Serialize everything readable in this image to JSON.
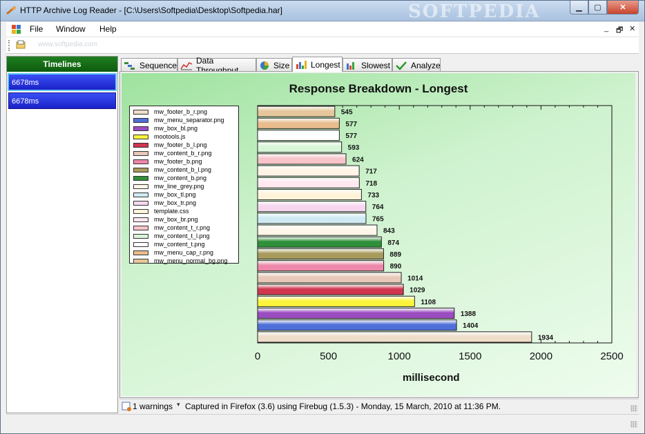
{
  "window": {
    "title": "HTTP Archive Log Reader - [C:\\Users\\Softpedia\\Desktop\\Softpedia.har]",
    "watermark": "SOFTPEDIA",
    "min_glyph": "▁",
    "max_glyph": "▢",
    "close_glyph": "✕"
  },
  "menu": {
    "file": "File",
    "window": "Window",
    "help": "Help",
    "mdi_min": "_",
    "mdi_restore": "🗗",
    "mdi_close": "✕"
  },
  "toolbar": {
    "watermark": "www.softpedia.com"
  },
  "sidebar": {
    "title": "Timelines",
    "items": [
      {
        "label": "6678ms"
      },
      {
        "label": "6678ms"
      }
    ]
  },
  "tabs": [
    {
      "label": "Sequence",
      "icon": "sequence-icon"
    },
    {
      "label": "Data Throughput",
      "icon": "throughput-icon"
    },
    {
      "label": "Size",
      "icon": "pie-chart-icon"
    },
    {
      "label": "Longest",
      "icon": "bar-chart-icon"
    },
    {
      "label": "Slowest",
      "icon": "bar-chart-icon"
    },
    {
      "label": "Analyze",
      "icon": "checkmark-icon"
    }
  ],
  "active_tab": "Longest",
  "chart_data": {
    "type": "bar",
    "orientation": "horizontal",
    "title": "Response Breakdown - Longest",
    "xlabel": "millisecond",
    "xlim": [
      0,
      2500
    ],
    "xticks": [
      "0",
      "500",
      "1000",
      "1500",
      "2000",
      "2500"
    ],
    "bars_top_to_bottom": [
      545,
      577,
      577,
      593,
      624,
      717,
      718,
      733,
      764,
      765,
      843,
      874,
      889,
      890,
      1014,
      1029,
      1108,
      1388,
      1404,
      1934
    ],
    "bar_colors": [
      "#e6c79c",
      "#e9bc8e",
      "#ffffff",
      "#d8f5d8",
      "#f7c4c9",
      "#fff4e6",
      "#ffe8ef",
      "#fff3da",
      "#f6d6ef",
      "#cfeaf2",
      "#fff6ea",
      "#2f8f3a",
      "#a89a5c",
      "#ee88aa",
      "#e8c8b8",
      "#d0364e",
      "#fbf43c",
      "#9a4cc0",
      "#4f6fd8",
      "#eeddc8"
    ],
    "legend": [
      {
        "label": "mw_footer_b_r.png",
        "color": "#eeddc8"
      },
      {
        "label": "mw_menu_separator.png",
        "color": "#4f6fd8"
      },
      {
        "label": "mw_box_bl.png",
        "color": "#9a4cc0"
      },
      {
        "label": "mootools.js",
        "color": "#fbf43c"
      },
      {
        "label": "mw_footer_b_l.png",
        "color": "#d0364e"
      },
      {
        "label": "mw_content_b_r.png",
        "color": "#e8c8b8"
      },
      {
        "label": "mw_footer_b.png",
        "color": "#ee88aa"
      },
      {
        "label": "mw_content_b_l.png",
        "color": "#a89a5c"
      },
      {
        "label": "mw_content_b.png",
        "color": "#2f8f3a"
      },
      {
        "label": "mw_line_grey.png",
        "color": "#fff6ea"
      },
      {
        "label": "mw_box_tl.png",
        "color": "#cfeaf2"
      },
      {
        "label": "mw_box_tr.png",
        "color": "#f6d6ef"
      },
      {
        "label": "template.css",
        "color": "#fff3da"
      },
      {
        "label": "mw_box_br.png",
        "color": "#ffe8ef"
      },
      {
        "label": "mw_content_t_r.png",
        "color": "#f7c4c9"
      },
      {
        "label": "mw_content_t_l.png",
        "color": "#d8f5d8"
      },
      {
        "label": "mw_content_t.png",
        "color": "#ffffff"
      },
      {
        "label": "mw_menu_cap_r.png",
        "color": "#e9bc8e"
      },
      {
        "label": "mw_menu_normal_bg.png",
        "color": "#e6c79c"
      }
    ]
  },
  "status": {
    "warnings": "1 warnings",
    "dropdown": "▾",
    "text": "Captured in Firefox (3.6) using Firebug (1.5.3) - Monday, 15 March, 2010 at 11:36 PM."
  }
}
